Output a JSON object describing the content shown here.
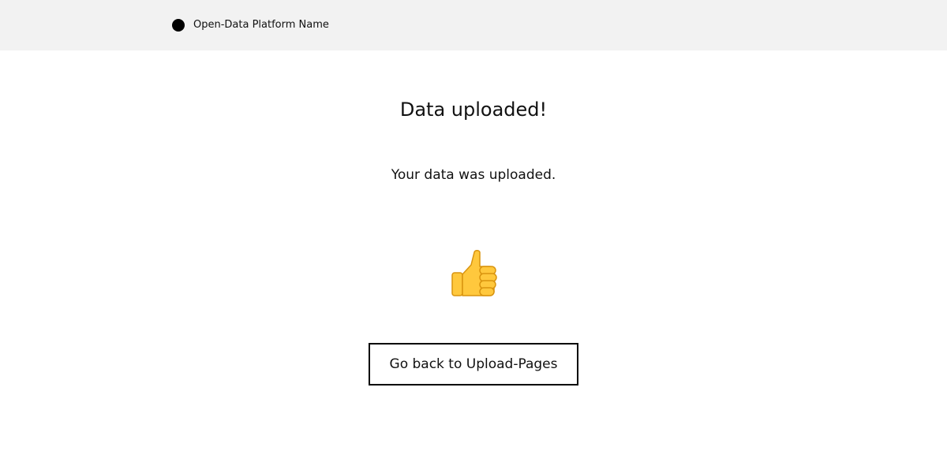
{
  "header": {
    "platform_name": "Open-Data Platform Name"
  },
  "main": {
    "title": "Data uploaded!",
    "message": "Your data was uploaded.",
    "icon": "thumbs-up-icon",
    "back_button_label": "Go back to Upload-Pages"
  },
  "colors": {
    "header_bg": "#f2f2f2",
    "text": "#111111",
    "thumb_fill": "#ffc83d",
    "thumb_outline": "#d9940f"
  }
}
